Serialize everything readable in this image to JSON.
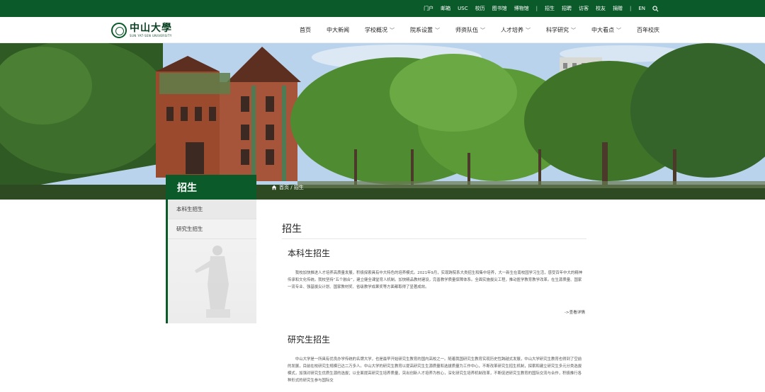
{
  "topbar": {
    "links": [
      "门户",
      "邮箱",
      "USC",
      "校历",
      "图书馆",
      "博物馆"
    ],
    "links2": [
      "招生",
      "招聘",
      "访客",
      "校友",
      "捐赠"
    ],
    "lang": "EN"
  },
  "header": {
    "logo_cn": "中山大學",
    "logo_en": "SUN YAT-SEN UNIVERSITY",
    "nav": [
      {
        "label": "首页",
        "has_menu": false
      },
      {
        "label": "中大新闻",
        "has_menu": false
      },
      {
        "label": "学校概况",
        "has_menu": true
      },
      {
        "label": "院系设置",
        "has_menu": true
      },
      {
        "label": "师资队伍",
        "has_menu": true
      },
      {
        "label": "人才培养",
        "has_menu": true
      },
      {
        "label": "科学研究",
        "has_menu": true
      },
      {
        "label": "中大看点",
        "has_menu": true
      },
      {
        "label": "百年校庆",
        "has_menu": false
      }
    ]
  },
  "banner": {
    "section_title": "招生",
    "breadcrumb": "首页 / 招生"
  },
  "sidebar": {
    "items": [
      {
        "label": "本科生招生"
      },
      {
        "label": "研究生招生"
      }
    ]
  },
  "main": {
    "title": "招生",
    "sections": [
      {
        "heading": "本科生招生",
        "text": "我校加快推进人才培养高质量发展，积极探索具有中大特色的培养模式。2021年9月，实现跨院系大类招生和集中培养，大一新生在南校园学习生活，感受百年中大的精神传承和文化传统。我校坚持“五个融合”，建立健全课堂育人机制。加快精品教材建设，完善教学质量保障体系。全面实施拔尖工程，推动医学教育教学改革。在生源质量、国家一流专业、强基拔尖计划、国家教材奖、省级教学成果奖等方面都取得了显著成效。",
        "more": "->查看详情"
      },
      {
        "heading": "研究生招生",
        "text": "中山大学是一所具有优良办学传统的名牌大学，也是最早开始研究生教育的国内高校之一。随着我国研究生教育实现历史性跨越式发展，中山大学研究生教育也得到了空前的发展，目前在校研究生规模已达二万多人。中山大学的研究生教育以提高研究生生源质量和选拔质量为工作中心，不断改革研究生招生机制，探索和建立研究生多元分类选拔模式，加强对研究生优质生源的选拔；以全面提高研究生培养质量，突出创新人才培养为核心，深化研究生培养机制改革，不断促进研究生教育的国际交流与合作，积极推行各种形式的研究生参与国际交",
        "more": ""
      }
    ]
  }
}
